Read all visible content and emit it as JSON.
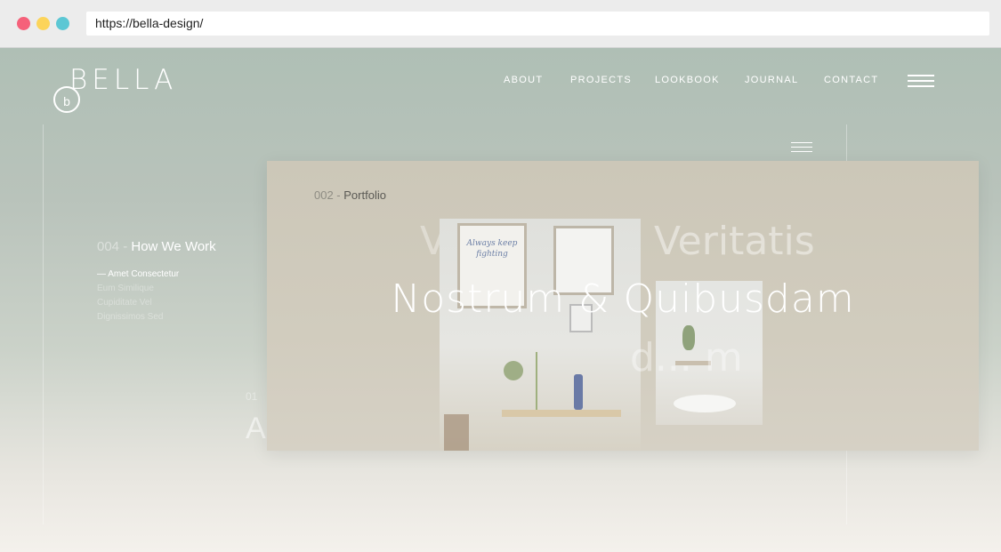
{
  "browser": {
    "url": "https://bella-design/"
  },
  "header": {
    "logo": "BELLA",
    "nav": [
      "ABOUT",
      "PROJECTS",
      "LOOKBOOK",
      "JOURNAL",
      "CONTACT"
    ]
  },
  "sidebar": {
    "mark": "b",
    "section_number": "004 -",
    "section_title": "How We Work",
    "items": [
      "— Amet Consectetur",
      "Eum Similique",
      "Cupiditate Vel",
      "Dignissimos Sed"
    ]
  },
  "ghost": {
    "number": "01",
    "letter": "A",
    "veritatis": "Veritatis",
    "v": "V",
    "dm": "d... m"
  },
  "card": {
    "section_number": "002 -",
    "section_title": "Portfolio",
    "headline": "Nostrum & Quibusdam",
    "poster_text": "Always keep fighting"
  },
  "colors": {
    "accent": "#ffffff",
    "page_top": "#afbfb5",
    "page_bottom": "#f4f1ec"
  }
}
